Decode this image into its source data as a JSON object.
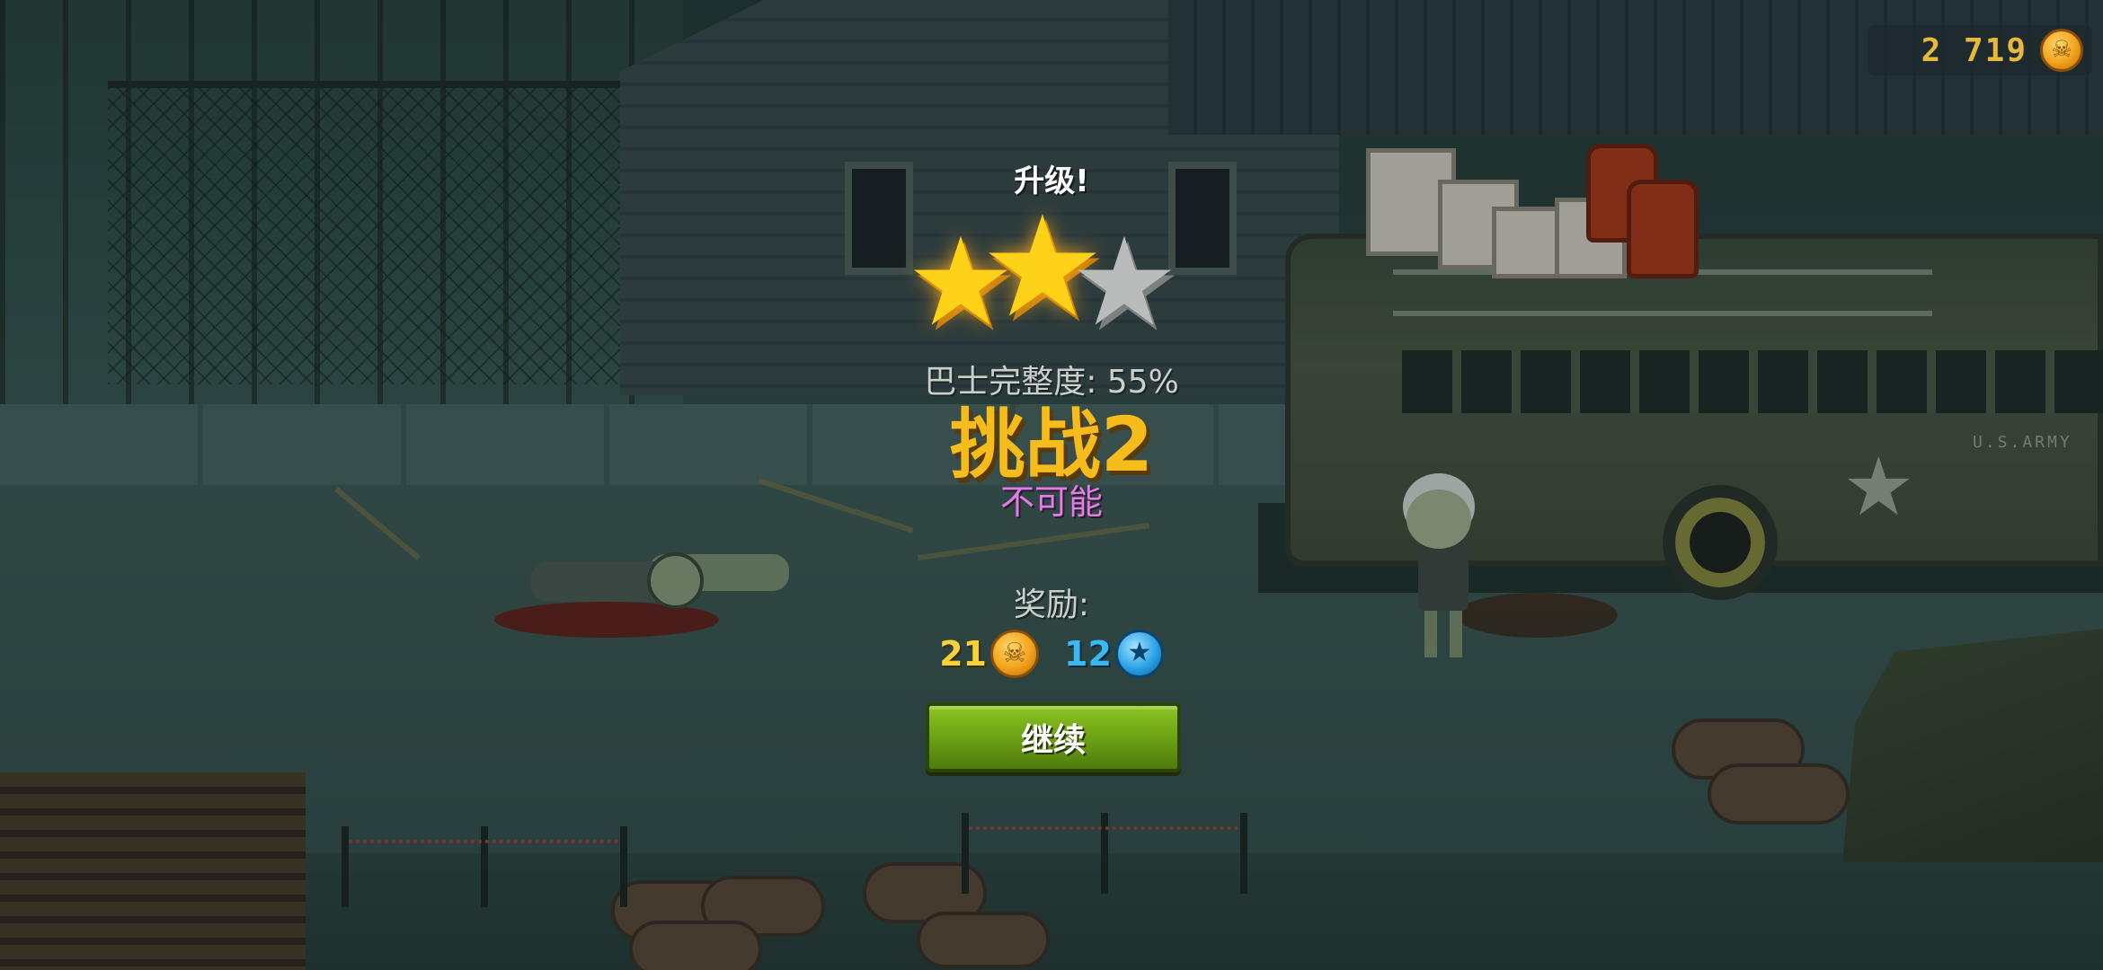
{
  "hud": {
    "coins": "2 719",
    "coin_icon": "skull-coin-icon"
  },
  "result": {
    "upgrade_label": "升级!",
    "stars": {
      "earned": 2,
      "total": 3
    },
    "integrity_label": "巴士完整度: 55%",
    "challenge_title": "挑战2",
    "difficulty": "不可能",
    "reward_label": "奖励:",
    "rewards": {
      "coins": "21",
      "gems": "12"
    },
    "continue_label": "继续"
  },
  "scene": {
    "bus_marking": "U.S.ARMY"
  },
  "colors": {
    "gold": "#f5bc1c",
    "difficulty": "#e37ce8",
    "button": "#6a9e14",
    "gem": "#3ab8f0"
  }
}
